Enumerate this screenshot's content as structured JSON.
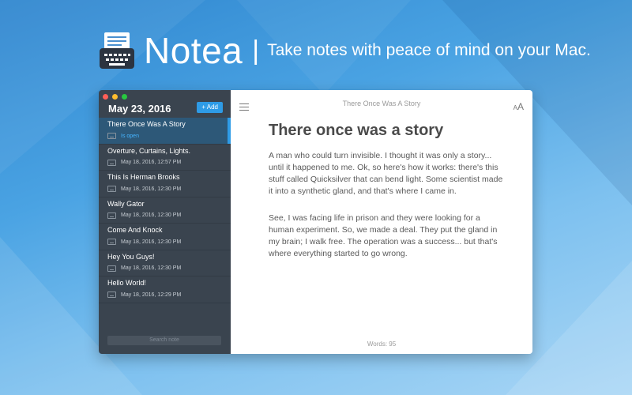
{
  "colors": {
    "background": "#3a93dc",
    "sidebar": "#3a444f",
    "active_note": "#2d5878",
    "accent": "#2e9be6",
    "status": "#46b4ff",
    "traffic_red": "#ff5f57",
    "traffic_yellow": "#febc2e",
    "traffic_green": "#28c840"
  },
  "hero": {
    "app_name": "Notea",
    "separator": "|",
    "tagline": "Take notes with peace of mind on  your Mac.",
    "icon": "typewriter-icon"
  },
  "sidebar": {
    "date": "May 23, 2016",
    "add_label": "+ Add",
    "search_placeholder": "Search note",
    "notes": [
      {
        "title": "There Once Was A Story",
        "meta": "Is open",
        "active": true
      },
      {
        "title": "Overture, Curtains, Lights.",
        "meta": "May 18, 2016, 12:57 PM"
      },
      {
        "title": "This Is Herman Brooks",
        "meta": "May 18, 2016, 12:30 PM"
      },
      {
        "title": "Wally Gator",
        "meta": "May 18, 2016, 12:30 PM"
      },
      {
        "title": "Come And Knock",
        "meta": "May 18, 2016, 12:30 PM"
      },
      {
        "title": "Hey You Guys!",
        "meta": "May 18, 2016, 12:30 PM"
      },
      {
        "title": "Hello World!",
        "meta": "May 18, 2016, 12:29 PM"
      }
    ]
  },
  "editor": {
    "window_title": "There Once Was A Story",
    "menu_icon": "hamburger-menu-icon",
    "font_icon_label": "AA",
    "heading": "There once was a story",
    "paragraphs": [
      "A man who could turn invisible. I thought it was only a story... until it happened to me. Ok, so here's how it works: there's this stuff called Quicksilver that can bend light. Some scientist made it into a synthetic gland, and that's where I came in.",
      "See, I was facing life in prison and they were looking for a human experiment. So, we made a deal. They put the gland in my brain; I walk free. The operation was a success... but that's where everything started to go wrong."
    ],
    "word_count": "Words: 95"
  }
}
